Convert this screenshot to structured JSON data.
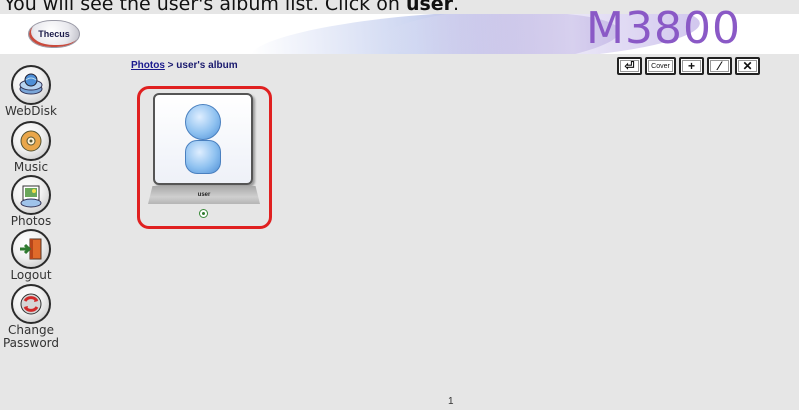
{
  "caption": {
    "text_before": "You will see the user's album list. Click on ",
    "text_bold": "user",
    "text_after": "."
  },
  "header": {
    "logo_text": "Thecus",
    "model": "M3800"
  },
  "toolbar": {
    "buttons": [
      {
        "name": "back-icon",
        "label": "⏎"
      },
      {
        "name": "cover-button",
        "label": "Cover"
      },
      {
        "name": "add-icon",
        "label": "+"
      },
      {
        "name": "edit-icon",
        "label": "⁄"
      },
      {
        "name": "delete-icon",
        "label": "✕"
      }
    ]
  },
  "breadcrumb": {
    "link": "Photos",
    "separator": " > ",
    "current": "user's album"
  },
  "sidebar": {
    "items": [
      {
        "label": "WebDisk",
        "icon": "webdisk-icon"
      },
      {
        "label": "Music",
        "icon": "music-icon"
      },
      {
        "label": "Photos",
        "icon": "photos-icon"
      },
      {
        "label": "Logout",
        "icon": "logout-icon"
      },
      {
        "label_line1": "Change",
        "label_line2": "Password",
        "icon": "change-password-icon"
      }
    ]
  },
  "album": {
    "name": "user"
  },
  "pagination": {
    "page": "1"
  },
  "colors": {
    "model": "#8a59c6",
    "highlight": "#e02020",
    "avatar": "#8ec1f0"
  }
}
